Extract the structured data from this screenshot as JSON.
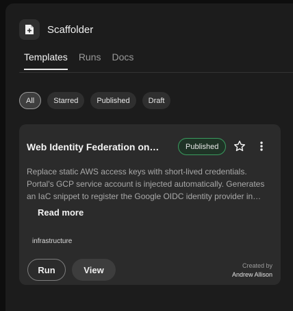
{
  "app": {
    "title": "Scaffolder",
    "icon": "file-plus-icon"
  },
  "tabs": [
    {
      "label": "Templates",
      "active": true
    },
    {
      "label": "Runs",
      "active": false
    },
    {
      "label": "Docs",
      "active": false
    }
  ],
  "filters": [
    {
      "label": "All",
      "selected": true
    },
    {
      "label": "Starred",
      "selected": false
    },
    {
      "label": "Published",
      "selected": false
    },
    {
      "label": "Draft",
      "selected": false
    }
  ],
  "card": {
    "title": "Web Identity Federation on…",
    "status": "Published",
    "status_color": "#3a9c5f",
    "description": "Replace static AWS access keys with short-lived credentials. Portal's GCP service account is injected automatically. Generates an IaC snippet to register the Google OIDC identity provider in…",
    "read_more": "Read more",
    "tag": "infrastructure",
    "run_label": "Run",
    "view_label": "View",
    "created_by_label": "Created by",
    "created_by_name": "Andrew Allison",
    "icons": {
      "star": "star-icon",
      "more": "more-vertical-icon"
    }
  }
}
